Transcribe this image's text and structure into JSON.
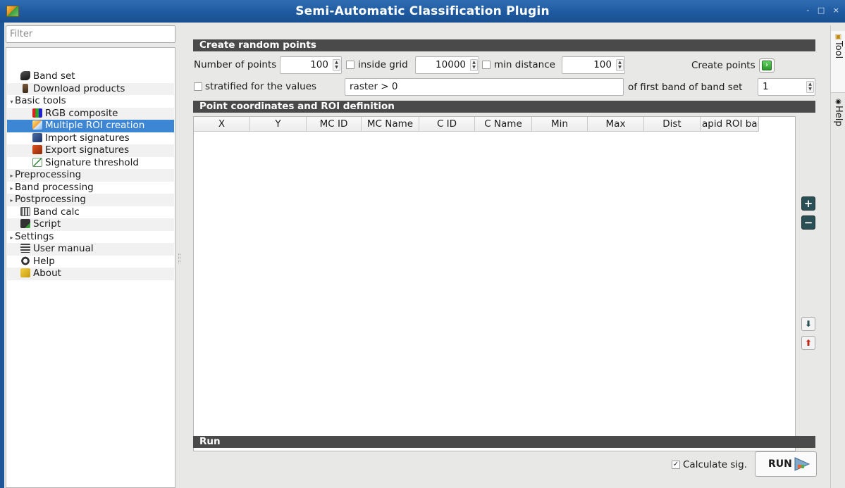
{
  "window": {
    "title": "Semi-Automatic Classification Plugin",
    "controls": "- □ ×"
  },
  "sidebar": {
    "filter_placeholder": "Filter",
    "items": [
      {
        "label": "Band set",
        "icon": "band-set-icon",
        "level": 1
      },
      {
        "label": "Download products",
        "icon": "download-icon",
        "level": 1
      },
      {
        "label": "Basic tools",
        "icon": "",
        "level": 0,
        "expanded": true
      },
      {
        "label": "RGB composite",
        "icon": "rgb-composite-icon",
        "level": 2
      },
      {
        "label": "Multiple ROI creation",
        "icon": "multiple-roi-icon",
        "level": 2,
        "selected": true
      },
      {
        "label": "Import signatures",
        "icon": "import-signatures-icon",
        "level": 2
      },
      {
        "label": "Export signatures",
        "icon": "export-signatures-icon",
        "level": 2
      },
      {
        "label": "Signature threshold",
        "icon": "signature-threshold-icon",
        "level": 2
      },
      {
        "label": "Preprocessing",
        "icon": "",
        "level": 0,
        "expanded": false
      },
      {
        "label": "Band processing",
        "icon": "",
        "level": 0,
        "expanded": false
      },
      {
        "label": "Postprocessing",
        "icon": "",
        "level": 0,
        "expanded": false
      },
      {
        "label": "Band calc",
        "icon": "band-calc-icon",
        "level": 1
      },
      {
        "label": "Script",
        "icon": "script-icon",
        "level": 1
      },
      {
        "label": "Settings",
        "icon": "",
        "level": 0,
        "expanded": false
      },
      {
        "label": "User manual",
        "icon": "user-manual-icon",
        "level": 1
      },
      {
        "label": "Help",
        "icon": "help-icon",
        "level": 1
      },
      {
        "label": "About",
        "icon": "about-icon",
        "level": 1
      }
    ]
  },
  "dock": {
    "tab_tool": "Tool",
    "tab_help": "Help"
  },
  "random_points": {
    "header": "Create random points",
    "number_label": "Number of points",
    "number_value": "100",
    "inside_grid_label": "inside grid",
    "inside_grid_checked": false,
    "grid_value": "10000",
    "min_distance_label": "min distance",
    "min_distance_checked": false,
    "min_distance_value": "100",
    "create_points_label": "Create points",
    "stratified_label": "stratified for the values",
    "stratified_checked": false,
    "expression": "raster > 0",
    "band_label": "of first band of band set",
    "band_value": "1"
  },
  "table": {
    "header": "Point coordinates and ROI definition",
    "columns": [
      "X",
      "Y",
      "MC ID",
      "MC Name",
      "C ID",
      "C Name",
      "Min",
      "Max",
      "Dist",
      "apid ROI bar"
    ]
  },
  "run": {
    "header": "Run",
    "calculate_sig_label": "Calculate sig.",
    "calculate_sig_checked": true,
    "run_label": "RUN"
  },
  "colors": {
    "titlebar": "#1f5aa0",
    "section_header": "#4a4a4a",
    "selection": "#3d86d4"
  }
}
